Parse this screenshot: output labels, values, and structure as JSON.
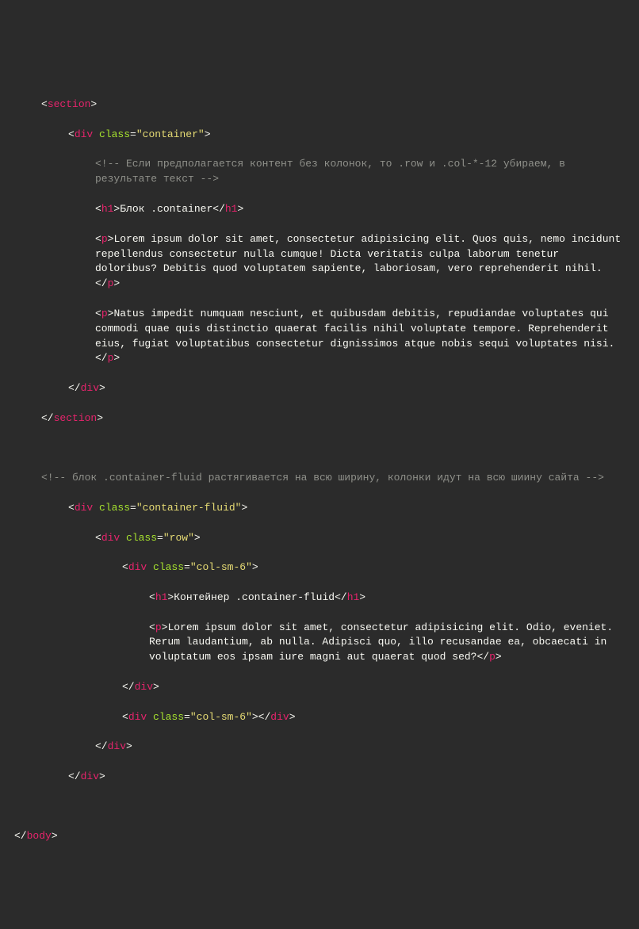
{
  "section": {
    "tag": "section",
    "div": {
      "tag": "div",
      "attr_class": "class",
      "class_val": "\"container\"",
      "comment": "<!-- Если предполагается контент без колонок, то .row и .col-*-12 убираем, в результате текст -->",
      "h1": {
        "tag": "h1",
        "text": "Блок .container"
      },
      "p1": {
        "tag": "p",
        "text": "Lorem ipsum dolor sit amet, consectetur adipisicing elit. Quos quis, nemo incidunt repellendus consectetur nulla cumque! Dicta veritatis culpa laborum tenetur doloribus? Debitis quod voluptatem sapiente, laboriosam, vero reprehenderit nihil."
      },
      "p2": {
        "tag": "p",
        "text": "Natus impedit numquam nesciunt, et quibusdam debitis, repudiandae voluptates qui commodi quae quis distinctio quaerat facilis nihil voluptate tempore. Reprehenderit eius, fugiat voluptatibus consectetur dignissimos atque nobis sequi voluptates nisi."
      }
    }
  },
  "comment_fluid": "<!-- блок .container-fluid растягивается на всю ширину, колонки идут на всю шиину сайта -->",
  "fluid": {
    "div": {
      "tag": "div",
      "attr_class": "class",
      "class_val": "\"container-fluid\"",
      "row": {
        "tag": "div",
        "attr_class": "class",
        "class_val": "\"row\"",
        "col1": {
          "tag": "div",
          "attr_class": "class",
          "class_val": "\"col-sm-6\"",
          "h1": {
            "tag": "h1",
            "text": "Контейнер .container-fluid"
          },
          "p": {
            "tag": "p",
            "text": "Lorem ipsum dolor sit amet, consectetur adipisicing elit. Odio, eveniet. Rerum laudantium, ab nulla. Adipisci quo, illo recusandae ea, obcaecati in voluptatum eos ipsam iure magni aut quaerat quod sed?"
          }
        },
        "col2": {
          "tag": "div",
          "attr_class": "class",
          "class_val": "\"col-sm-6\""
        }
      }
    }
  },
  "body_close": "body"
}
